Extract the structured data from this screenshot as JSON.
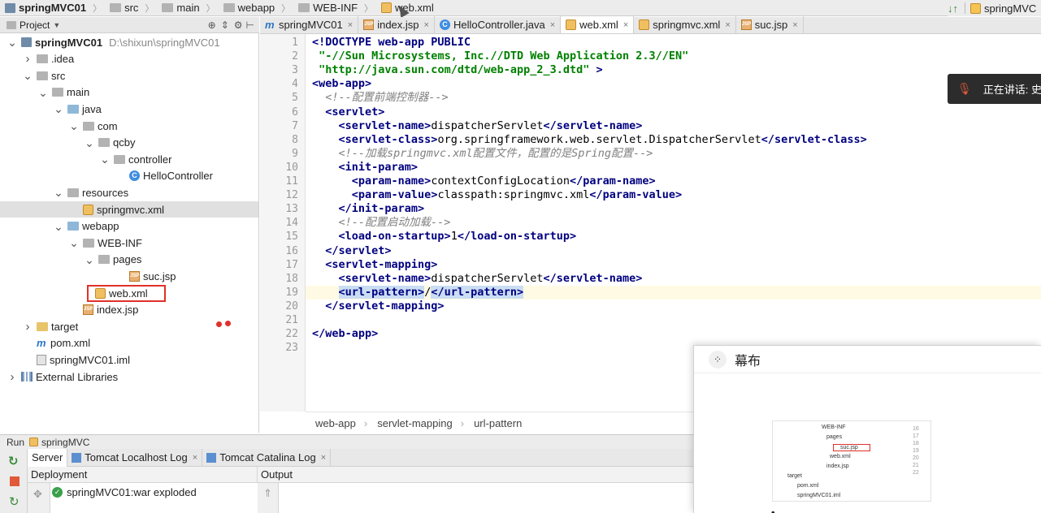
{
  "breadcrumb": [
    {
      "label": "springMVC01",
      "icon": "project-icon"
    },
    {
      "label": "src",
      "icon": "folder-icon"
    },
    {
      "label": "main",
      "icon": "folder-icon"
    },
    {
      "label": "webapp",
      "icon": "folder-icon"
    },
    {
      "label": "WEB-INF",
      "icon": "folder-icon"
    },
    {
      "label": "web.xml",
      "icon": "xml-file-icon"
    }
  ],
  "run_config": {
    "label": "springMVC"
  },
  "project_panel": {
    "title": "Project",
    "tree": [
      {
        "label": "springMVC01",
        "extra": "D:\\shixun\\springMVC01",
        "depth": 1,
        "arrow": "down",
        "icon": "project"
      },
      {
        "label": ".idea",
        "depth": 2,
        "arrow": "right",
        "icon": "folder-gray"
      },
      {
        "label": "src",
        "depth": 2,
        "arrow": "down",
        "icon": "folder-gray"
      },
      {
        "label": "main",
        "depth": 3,
        "arrow": "down",
        "icon": "folder-gray"
      },
      {
        "label": "java",
        "depth": 4,
        "arrow": "down",
        "icon": "folder-blue"
      },
      {
        "label": "com",
        "depth": 5,
        "arrow": "down",
        "icon": "folder-gray"
      },
      {
        "label": "qcby",
        "depth": 6,
        "arrow": "down",
        "icon": "folder-gray"
      },
      {
        "label": "controller",
        "depth": 7,
        "arrow": "down",
        "icon": "folder-gray"
      },
      {
        "label": "HelloController",
        "depth": 8,
        "arrow": "",
        "icon": "class"
      },
      {
        "label": "resources",
        "depth": 4,
        "arrow": "down",
        "icon": "folder-gray"
      },
      {
        "label": "springmvc.xml",
        "depth": 5,
        "arrow": "",
        "icon": "xml",
        "selected": true
      },
      {
        "label": "webapp",
        "depth": 4,
        "arrow": "down",
        "icon": "folder-blue"
      },
      {
        "label": "WEB-INF",
        "depth": 5,
        "arrow": "down",
        "icon": "folder-gray"
      },
      {
        "label": "pages",
        "depth": 6,
        "arrow": "down",
        "icon": "folder-gray"
      },
      {
        "label": "suc.jsp",
        "depth": 8,
        "arrow": "",
        "icon": "jsp"
      },
      {
        "label": "web.xml",
        "depth": 6,
        "arrow": "",
        "icon": "xml",
        "boxed": true
      },
      {
        "label": "index.jsp",
        "depth": 5,
        "arrow": "",
        "icon": "jsp"
      },
      {
        "label": "target",
        "depth": 2,
        "arrow": "right",
        "icon": "folder-yellow"
      },
      {
        "label": "pom.xml",
        "depth": 2,
        "arrow": "",
        "icon": "maven"
      },
      {
        "label": "springMVC01.iml",
        "depth": 2,
        "arrow": "",
        "icon": "iml"
      },
      {
        "label": "External Libraries",
        "depth": 1,
        "arrow": "right",
        "icon": "library"
      }
    ]
  },
  "editor_tabs": [
    {
      "label": "springMVC01",
      "icon": "maven"
    },
    {
      "label": "index.jsp",
      "icon": "jsp"
    },
    {
      "label": "HelloController.java",
      "icon": "class"
    },
    {
      "label": "web.xml",
      "icon": "xml",
      "active": true
    },
    {
      "label": "springmvc.xml",
      "icon": "xml"
    },
    {
      "label": "suc.jsp",
      "icon": "jsp"
    }
  ],
  "code_lines": [
    "<!DOCTYPE web-app PUBLIC",
    " \"-//Sun Microsystems, Inc.//DTD Web Application 2.3//EN\"",
    " \"http://java.sun.com/dtd/web-app_2_3.dtd\" >",
    "<web-app>",
    "  <!--配置前端控制器-->",
    "  <servlet>",
    "    <servlet-name>dispatcherServlet</servlet-name>",
    "    <servlet-class>org.springframework.web.servlet.DispatcherServlet</servlet-class>",
    "    <!--加载springmvc.xml配置文件，配置的是Spring配置-->",
    "    <init-param>",
    "      <param-name>contextConfigLocation</param-name>",
    "      <param-value>classpath:springmvc.xml</param-value>",
    "    </init-param>",
    "    <!--配置启动加载-->",
    "    <load-on-startup>1</load-on-startup>",
    "  </servlet>",
    "  <servlet-mapping>",
    "    <servlet-name>dispatcherServlet</servlet-name>",
    "    <url-pattern>/</url-pattern>",
    "  </servlet-mapping>",
    "",
    "</web-app>",
    ""
  ],
  "code_breadcrumb": [
    "web-app",
    "servlet-mapping",
    "url-pattern"
  ],
  "run_panel": {
    "title_prefix": "Run",
    "title": "springMVC",
    "tabs": [
      "Server",
      "Tomcat Localhost Log",
      "Tomcat Catalina Log"
    ],
    "deployment_header": "Deployment",
    "output_header": "Output",
    "deployment_item": "springMVC01:war exploded"
  },
  "floating_window": {
    "title": "幕布",
    "thumb_tree": [
      "WEB-INF",
      "pages",
      "suc.jsp",
      "web.xml",
      "index.jsp",
      "target",
      "pom.xml",
      "springMVC01.iml"
    ],
    "thumb_lines": [
      "16",
      "17",
      "18",
      "19",
      "20",
      "21",
      "22"
    ]
  },
  "speaking_toast": {
    "label": "正在讲话: 史"
  },
  "colors": {
    "tag": "#000080",
    "string": "#008000",
    "comment": "#808080",
    "highlight_red": "#e0302a"
  }
}
